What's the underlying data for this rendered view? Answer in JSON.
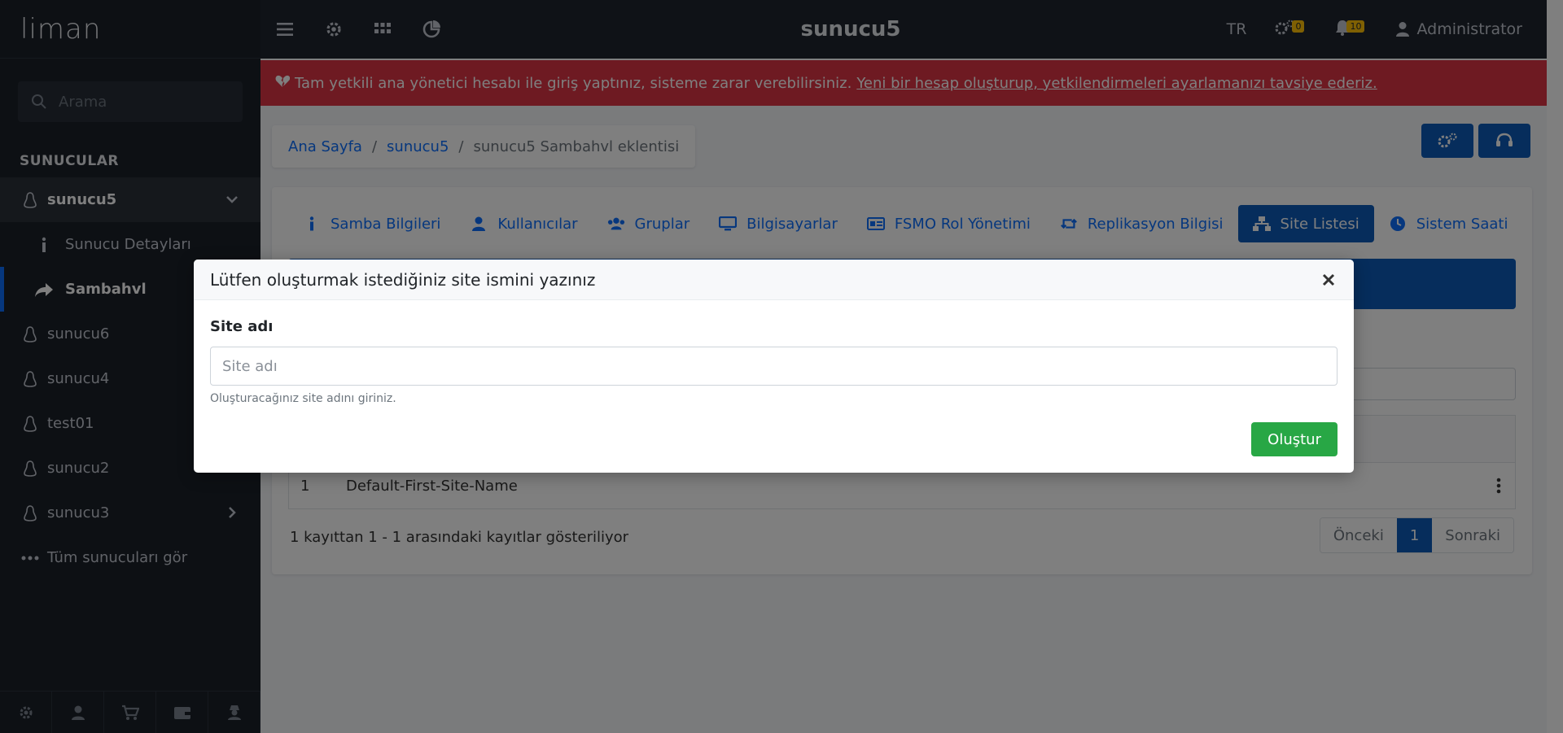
{
  "sidebar": {
    "brand": "liman",
    "search_placeholder": "Arama",
    "section_title": "SUNUCULAR",
    "servers": [
      {
        "label": "sunucu5",
        "expanded": true
      },
      {
        "label": "sunucu6"
      },
      {
        "label": "sunucu4"
      },
      {
        "label": "test01"
      },
      {
        "label": "sunucu2"
      },
      {
        "label": "sunucu3"
      }
    ],
    "sub_items": [
      {
        "label": "Sunucu Detayları"
      },
      {
        "label": "Sambahvl"
      }
    ],
    "see_all": "Tüm sunucuları gör"
  },
  "topbar": {
    "title": "sunucu5",
    "language": "TR",
    "gear_badge": "0",
    "bell_badge": "10",
    "user": "Administrator"
  },
  "alert": {
    "text": "Tam yetkili ana yönetici hesabı ile giriş yaptınız, sisteme zarar verebilirsiniz.",
    "link": "Yeni bir hesap oluşturup, yetkilendirmeleri ayarlamanızı tavsiye ederiz."
  },
  "breadcrumb": {
    "home": "Ana Sayfa",
    "server": "sunucu5",
    "current": "sunucu5 Sambahvl eklentisi"
  },
  "tabs": [
    {
      "label": "Samba Bilgileri",
      "icon": "info-icon"
    },
    {
      "label": "Kullanıcılar",
      "icon": "user-icon"
    },
    {
      "label": "Gruplar",
      "icon": "users-icon"
    },
    {
      "label": "Bilgisayarlar",
      "icon": "monitor-icon"
    },
    {
      "label": "FSMO Rol Yönetimi",
      "icon": "id-card-icon"
    },
    {
      "label": "Replikasyon Bilgisi",
      "icon": "retweet-icon"
    },
    {
      "label": "Site Listesi",
      "icon": "sitemap-icon",
      "active": true
    },
    {
      "label": "Sistem Saati",
      "icon": "clock-icon"
    }
  ],
  "table": {
    "rows": [
      {
        "index": "1",
        "name": "Default-First-Site-Name"
      }
    ],
    "info": "1 kayıttan 1 - 1 arasındaki kayıtlar gösteriliyor",
    "prev": "Önceki",
    "page": "1",
    "next": "Sonraki"
  },
  "modal": {
    "title": "Lütfen oluşturmak istediğiniz site ismini yazınız",
    "field_label": "Site adı",
    "field_placeholder": "Site adı",
    "field_value": "",
    "field_help": "Oluşturacağınız site adını giriniz.",
    "submit_label": "Oluştur"
  },
  "colors": {
    "primary": "#0d5ab8",
    "danger": "#dc3545",
    "success": "#28a745",
    "sidebar_bg": "#1a2029",
    "badge": "#ffc107"
  }
}
